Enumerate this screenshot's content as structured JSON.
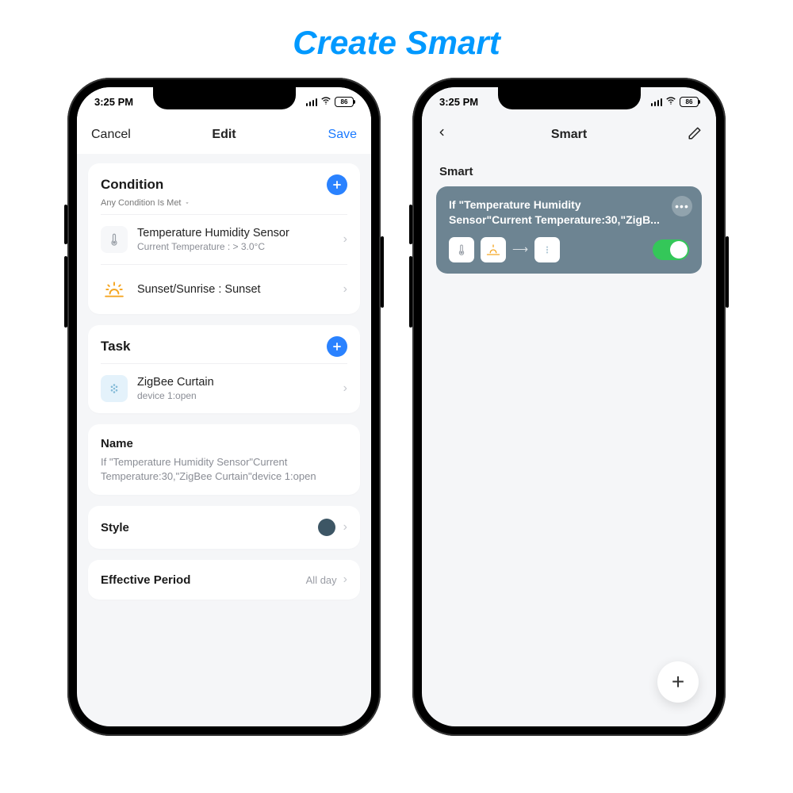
{
  "page": {
    "title": "Create Smart"
  },
  "status": {
    "time": "3:25 PM",
    "battery": "86"
  },
  "phone1": {
    "nav": {
      "cancel": "Cancel",
      "title": "Edit",
      "save": "Save"
    },
    "condition": {
      "heading": "Condition",
      "subtext": "Any Condition Is Met",
      "items": [
        {
          "title": "Temperature Humidity Sensor",
          "sub": "Current Temperature : > 3.0°C",
          "icon": "thermometer"
        },
        {
          "title": "Sunset/Sunrise : Sunset",
          "sub": "",
          "icon": "sunset"
        }
      ]
    },
    "task": {
      "heading": "Task",
      "items": [
        {
          "title": "ZigBee Curtain",
          "sub": "device 1:open",
          "icon": "curtain"
        }
      ]
    },
    "name": {
      "label": "Name",
      "value": "If \"Temperature Humidity Sensor\"Current Temperature:30,\"ZigBee Curtain\"device 1:open"
    },
    "style": {
      "label": "Style",
      "color": "#3d5665"
    },
    "period": {
      "label": "Effective Period",
      "value": "All day"
    }
  },
  "phone2": {
    "nav": {
      "title": "Smart"
    },
    "section": "Smart",
    "card": {
      "title": "If \"Temperature Humidity Sensor\"Current Temperature:30,\"ZigB...",
      "enabled": true
    }
  }
}
